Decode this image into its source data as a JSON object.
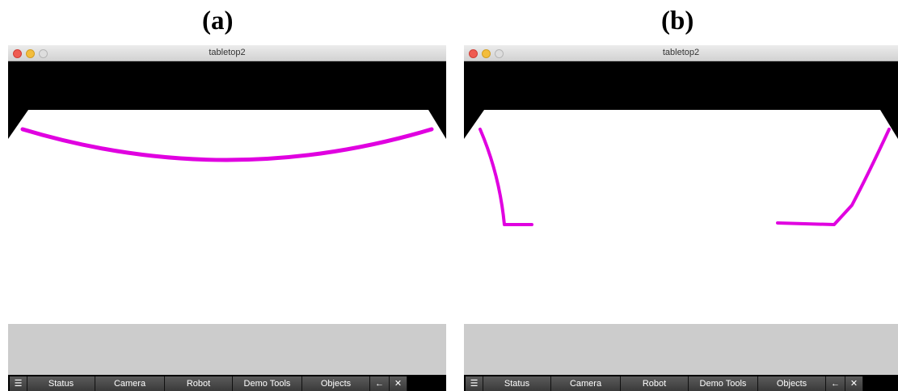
{
  "panels": [
    {
      "label": "(a)",
      "window_title": "tabletop2",
      "toolbar": {
        "menu_icon": "list-icon",
        "buttons": [
          "Status",
          "Camera",
          "Robot",
          "Demo Tools",
          "Objects"
        ],
        "back_icon": "arrow-left-icon",
        "close_icon": "close-icon"
      }
    },
    {
      "label": "(b)",
      "window_title": "tabletop2",
      "toolbar": {
        "menu_icon": "list-icon",
        "buttons": [
          "Status",
          "Camera",
          "Robot",
          "Demo Tools",
          "Objects"
        ],
        "back_icon": "arrow-left-icon",
        "close_icon": "close-icon"
      }
    }
  ],
  "colors": {
    "trajectory": "#e000e0",
    "background_black": "#000000",
    "floor_gray": "#cccccc",
    "table_white": "#ffffff"
  }
}
